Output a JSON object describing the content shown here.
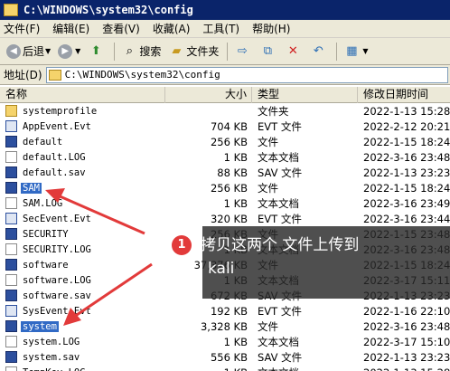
{
  "window": {
    "title": "C:\\WINDOWS\\system32\\config"
  },
  "menu": {
    "items": [
      "文件(F)",
      "编辑(E)",
      "查看(V)",
      "收藏(A)",
      "工具(T)",
      "帮助(H)"
    ]
  },
  "toolbar": {
    "back_label": "后退",
    "search_label": "搜索",
    "folders_label": "文件夹"
  },
  "address": {
    "label": "地址(D)",
    "value": "C:\\WINDOWS\\system32\\config"
  },
  "columns": {
    "name": "名称",
    "size": "大小",
    "type": "类型",
    "date": "修改日期时间"
  },
  "files": [
    {
      "name": "systemprofile",
      "size": "",
      "type": "文件夹",
      "date": "2022-1-13 15:28",
      "icon": "folder"
    },
    {
      "name": "AppEvent.Evt",
      "size": "704 KB",
      "type": "EVT 文件",
      "date": "2022-2-12 20:21",
      "icon": "evt"
    },
    {
      "name": "default",
      "size": "256 KB",
      "type": "文件",
      "date": "2022-1-15 18:24",
      "icon": "sys"
    },
    {
      "name": "default.LOG",
      "size": "1 KB",
      "type": "文本文档",
      "date": "2022-3-16 23:48",
      "icon": "txt"
    },
    {
      "name": "default.sav",
      "size": "88 KB",
      "type": "SAV 文件",
      "date": "2022-1-13 23:23",
      "icon": "sys"
    },
    {
      "name": "SAM",
      "size": "256 KB",
      "type": "文件",
      "date": "2022-1-15 18:24",
      "icon": "sys"
    },
    {
      "name": "SAM.LOG",
      "size": "1 KB",
      "type": "文本文档",
      "date": "2022-3-16 23:49",
      "icon": "txt"
    },
    {
      "name": "SecEvent.Evt",
      "size": "320 KB",
      "type": "EVT 文件",
      "date": "2022-3-16 23:44",
      "icon": "evt"
    },
    {
      "name": "SECURITY",
      "size": "256 KB",
      "type": "文件",
      "date": "2022-1-15 23:48",
      "icon": "sys"
    },
    {
      "name": "SECURITY.LOG",
      "size": "1 KB",
      "type": "文本文档",
      "date": "2022-3-16 23:48",
      "icon": "txt"
    },
    {
      "name": "software",
      "size": "37,376 KB",
      "type": "文件",
      "date": "2022-1-15 18:24",
      "icon": "sys"
    },
    {
      "name": "software.LOG",
      "size": "1 KB",
      "type": "文本文档",
      "date": "2022-3-17 15:11",
      "icon": "txt"
    },
    {
      "name": "software.sav",
      "size": "672 KB",
      "type": "SAV 文件",
      "date": "2022-1-13 23:23",
      "icon": "sys"
    },
    {
      "name": "SysEvent.Evt",
      "size": "192 KB",
      "type": "EVT 文件",
      "date": "2022-1-16 22:10",
      "icon": "evt"
    },
    {
      "name": "system",
      "size": "3,328 KB",
      "type": "文件",
      "date": "2022-3-16 23:48",
      "icon": "sys"
    },
    {
      "name": "system.LOG",
      "size": "1 KB",
      "type": "文本文档",
      "date": "2022-3-17 15:10",
      "icon": "txt"
    },
    {
      "name": "system.sav",
      "size": "556 KB",
      "type": "SAV 文件",
      "date": "2022-1-13 23:23",
      "icon": "sys"
    },
    {
      "name": "TempKey.LOG",
      "size": "1 KB",
      "type": "文本文档",
      "date": "2022-1-13 15:28",
      "icon": "txt"
    }
  ],
  "annotation": {
    "badge": "1",
    "text_line1": "拷贝这两个 文件上传到",
    "text_line2": "kali"
  },
  "colors": {
    "title_bar": "#0a246a",
    "selection": "#316ac5",
    "arrow": "#e23a3a"
  }
}
